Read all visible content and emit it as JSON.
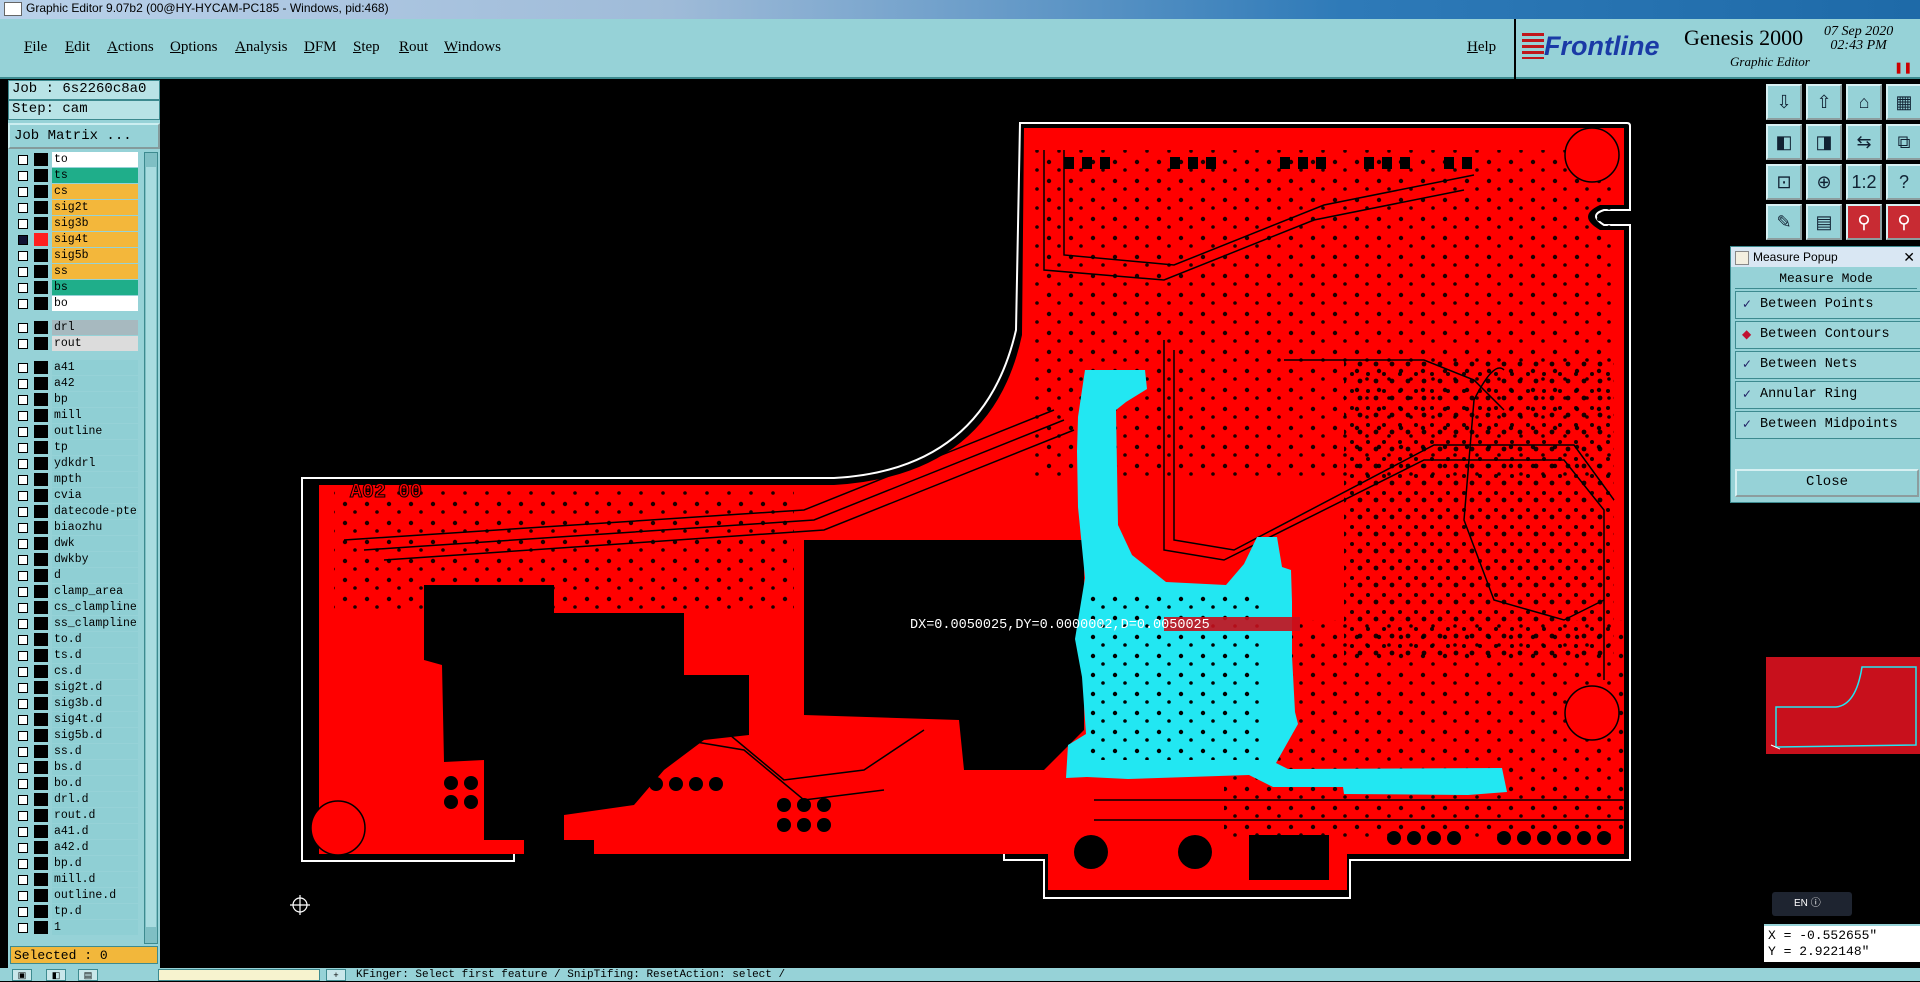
{
  "window": {
    "title": "Graphic Editor 9.07b2 (00@HY-HYCAM-PC185 - Windows, pid:468)"
  },
  "menu": [
    "File",
    "Edit",
    "Actions",
    "Options",
    "Analysis",
    "DFM",
    "Step",
    "Rout",
    "Windows"
  ],
  "help_label": "Help",
  "brand": {
    "logo": "Frontline",
    "product": "Genesis 2000",
    "subtitle": "Graphic Editor",
    "date": "07 Sep 2020",
    "time": "02:43 PM",
    "pause": "❚❚"
  },
  "left_panel": {
    "job": "Job : 6s2260c8a0",
    "step": "Step: cam",
    "job_matrix": "Job Matrix ...",
    "selected": "Selected : 0",
    "layer_groups": [
      [
        {
          "name": "to",
          "bg": "#ffffff",
          "checked": false
        },
        {
          "name": "ts",
          "bg": "#1fae8a",
          "checked": false
        },
        {
          "name": "cs",
          "bg": "#f3b73b",
          "checked": false
        },
        {
          "name": "sig2t",
          "bg": "#f3b73b",
          "checked": false
        },
        {
          "name": "sig3b",
          "bg": "#f3b73b",
          "checked": false
        },
        {
          "name": "sig4t",
          "bg": "#f3b73b",
          "checked": true,
          "active": true
        },
        {
          "name": "sig5b",
          "bg": "#f3b73b",
          "checked": false
        },
        {
          "name": "ss",
          "bg": "#f3b73b",
          "checked": false
        },
        {
          "name": "bs",
          "bg": "#1fae8a",
          "checked": false
        },
        {
          "name": "bo",
          "bg": "#ffffff",
          "checked": false
        }
      ],
      [
        {
          "name": "drl",
          "bg": "#a7b9bf",
          "checked": false
        },
        {
          "name": "rout",
          "bg": "#dcdcdc",
          "checked": false
        }
      ],
      [
        {
          "name": "a41"
        },
        {
          "name": "a42"
        },
        {
          "name": "bp"
        },
        {
          "name": "mill"
        },
        {
          "name": "outline"
        },
        {
          "name": "tp"
        },
        {
          "name": "ydkdrl"
        },
        {
          "name": "mpth"
        },
        {
          "name": "cvia"
        },
        {
          "name": "datecode-pte"
        },
        {
          "name": "biaozhu"
        },
        {
          "name": "dwk"
        },
        {
          "name": "dwkby"
        },
        {
          "name": "d"
        },
        {
          "name": "clamp_area"
        },
        {
          "name": "cs_clampline"
        },
        {
          "name": "ss_clampline"
        },
        {
          "name": "to.d"
        },
        {
          "name": "ts.d"
        },
        {
          "name": "cs.d"
        },
        {
          "name": "sig2t.d"
        },
        {
          "name": "sig3b.d"
        },
        {
          "name": "sig4t.d"
        },
        {
          "name": "sig5b.d"
        },
        {
          "name": "ss.d"
        },
        {
          "name": "bs.d"
        },
        {
          "name": "bo.d"
        },
        {
          "name": "drl.d"
        },
        {
          "name": "rout.d"
        },
        {
          "name": "a41.d"
        },
        {
          "name": "a42.d"
        },
        {
          "name": "bp.d"
        },
        {
          "name": "mill.d"
        },
        {
          "name": "outline.d"
        },
        {
          "name": "tp.d"
        },
        {
          "name": "1"
        }
      ]
    ]
  },
  "canvas": {
    "board_label": "A02 00",
    "measurement": "DX=0.0050025,DY=0.0000002,D=0.0050025",
    "colors": {
      "copper": "#ff0000",
      "selected_fill": "#22e7f2",
      "outline": "#ffffff"
    }
  },
  "measure_popup": {
    "title": "Measure Popup",
    "mode_header": "Measure Mode",
    "options": [
      {
        "label": "Between Points",
        "selected": false
      },
      {
        "label": "Between Contours",
        "selected": true
      },
      {
        "label": "Between Nets",
        "selected": false
      },
      {
        "label": "Annular Ring",
        "selected": false
      },
      {
        "label": "Between Midpoints",
        "selected": false
      }
    ],
    "close_label": "Close"
  },
  "toolbar_icons": [
    "zoom-home-icon",
    "zoom-in-icon",
    "house-icon",
    "grid-icon",
    "pan-left-icon",
    "pan-right-icon",
    "swap-icon",
    "split-icon",
    "fit-icon",
    "center-icon",
    "scale-1-2-icon",
    "help-icon",
    "measure-icon",
    "grid-toggle-icon",
    "snap-icon",
    "snap2-icon"
  ],
  "toolbar_labels": [
    "⇩",
    "⇧",
    "⌂",
    "▦",
    "◧",
    "◨",
    "⇆",
    "⧉",
    "⊡",
    "⊕",
    "1:2",
    "?",
    "✎",
    "▤",
    "⚲",
    "⚲"
  ],
  "ime": {
    "text": "EN"
  },
  "coords": {
    "x": "X = -0.552655\"",
    "y": "Y = 2.922148\""
  },
  "status": {
    "message": "KFinger: Select first feature / SnipTifing: ResetAction: select /"
  }
}
